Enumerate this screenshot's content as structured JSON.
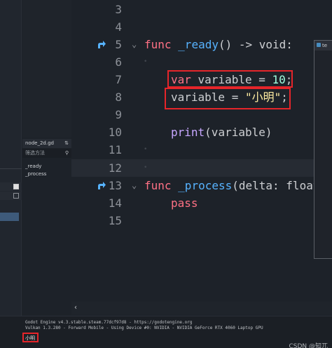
{
  "script_list": {
    "file_name": "node_2d.gd",
    "sort_icon": "sort-icon",
    "filter_placeholder": "筛选方法",
    "search_icon": "search-icon",
    "methods": [
      "_ready",
      "_process"
    ]
  },
  "editor": {
    "lines": [
      {
        "num": "3"
      },
      {
        "num": "4"
      },
      {
        "num": "5"
      },
      {
        "num": "6"
      },
      {
        "num": "7"
      },
      {
        "num": "8"
      },
      {
        "num": "9"
      },
      {
        "num": "10"
      },
      {
        "num": "11"
      },
      {
        "num": "12"
      },
      {
        "num": "13"
      },
      {
        "num": "14"
      },
      {
        "num": "15"
      }
    ],
    "code": {
      "l5_kw": "func",
      "l5_name": "_ready",
      "l5_rest": "() -> ",
      "l5_type": "void",
      "l5_end": ":",
      "l7_kw": "var",
      "l7_rest": " variable = ",
      "l7_num": "10",
      "l7_end": ";",
      "l8_rest": "variable = ",
      "l8_str": "\"小明\"",
      "l8_end": ";",
      "l10_call": "print",
      "l10_rest": "(variable)",
      "l13_kw": "func",
      "l13_name": "_process",
      "l13_rest": "(delta: ",
      "l13_type": "float",
      "l14_kw": "pass"
    },
    "colors": {
      "keyword": "#ff7185",
      "function": "#57b3ff",
      "number": "#a1ffe0",
      "string": "#ffeda1",
      "highlight_box": "#e5252a"
    }
  },
  "floating_window": {
    "title": "te"
  },
  "output": {
    "line1": "Godot Engine v4.3.stable.steam.77dcf97d8 - https://godotengine.org",
    "line2": "Vulkan 1.3.280 - Forward Mobile - Using Device #0: NVIDIA - NVIDIA GeForce RTX 4060 Laptop GPU",
    "result": "小明"
  },
  "watermark": "CSDN @知兀"
}
